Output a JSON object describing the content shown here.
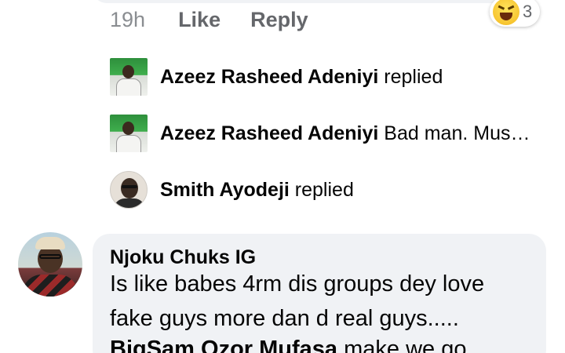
{
  "top_comment": {
    "time": "19h",
    "like_label": "Like",
    "reply_label": "Reply",
    "reaction": {
      "icon": "haha-emoji-icon",
      "count": "3"
    }
  },
  "replies": [
    {
      "name": "Azeez Rasheed Adeniyi",
      "text": "replied"
    },
    {
      "name": "Azeez Rasheed Adeniyi",
      "text": "Bad man. Mus…"
    },
    {
      "name": "Smith Ayodeji",
      "text": "replied"
    }
  ],
  "comment": {
    "author": "Njoku Chuks IG",
    "line1": "Is like babes 4rm dis groups dey love",
    "line2": "fake guys more dan d real guys.....",
    "mention": "BigSam Ozor Mufasa",
    "line3_rest": " make we go"
  },
  "colors": {
    "bubble_bg": "#f0f2f5",
    "meta_text": "#65676b",
    "text": "#050505"
  }
}
